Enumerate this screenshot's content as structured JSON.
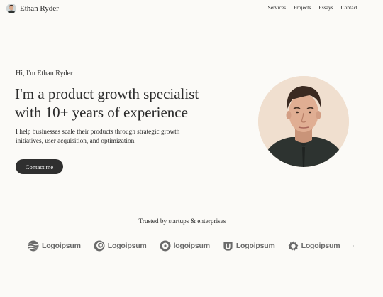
{
  "header": {
    "brand_name": "Ethan Ryder",
    "nav": [
      "Services",
      "Projects",
      "Essays",
      "Contact"
    ]
  },
  "hero": {
    "greeting": "Hi, I'm Ethan Ryder",
    "title": "I'm a product growth specialist with 10+ years of experience",
    "description": "I help businesses scale their products through strategic growth initiatives, user acquisition, and optimization.",
    "cta_label": "Contact me"
  },
  "trusted": {
    "label": "Trusted by startups & enterprises",
    "logos": [
      {
        "text": "Logoipsum",
        "icon": "wave-globe-icon"
      },
      {
        "text": "Logoipsum",
        "icon": "swirl-circle-icon"
      },
      {
        "text": "logoipsum",
        "icon": "ring-icon"
      },
      {
        "text": "Logoipsum",
        "icon": "shield-u-icon"
      },
      {
        "text": "Logoipsum",
        "icon": "gear-ring-icon"
      },
      {
        "text": "",
        "icon": "sunburst-icon"
      }
    ]
  },
  "colors": {
    "background": "#fbfaf7",
    "text": "#2b2b2b",
    "button": "#2f2f2f",
    "portrait_bg": "#f0dfcf",
    "logo": "#6a6a6a"
  }
}
